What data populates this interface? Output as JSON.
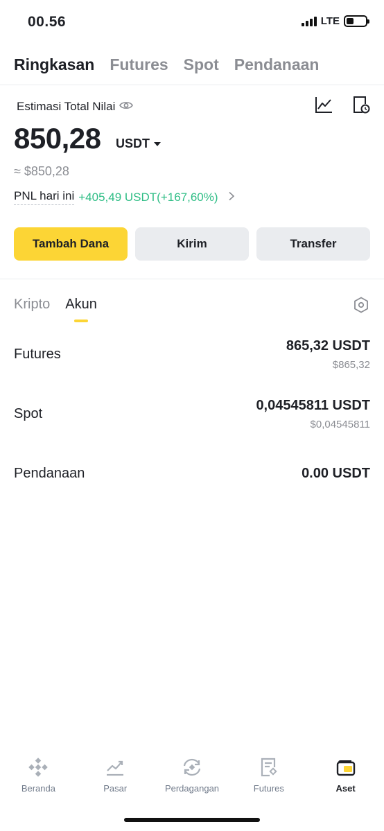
{
  "status": {
    "time": "00.56",
    "network": "LTE"
  },
  "top_tabs": [
    {
      "label": "Ringkasan",
      "active": true
    },
    {
      "label": "Futures",
      "active": false
    },
    {
      "label": "Spot",
      "active": false
    },
    {
      "label": "Pendanaan",
      "active": false
    }
  ],
  "summary": {
    "label": "Estimasi Total Nilai",
    "value": "850,28",
    "unit": "USDT",
    "usd_approx": "≈ $850,28",
    "pnl_label": "PNL hari ini",
    "pnl_value": "+405,49 USDT(+167,60%)"
  },
  "actions": {
    "deposit": "Tambah Dana",
    "send": "Kirim",
    "transfer": "Transfer"
  },
  "sub_tabs": [
    {
      "label": "Kripto",
      "active": false
    },
    {
      "label": "Akun",
      "active": true
    }
  ],
  "accounts": [
    {
      "name": "Futures",
      "value": "865,32 USDT",
      "usd": "$865,32"
    },
    {
      "name": "Spot",
      "value": "0,04545811 USDT",
      "usd": "$0,04545811"
    },
    {
      "name": "Pendanaan",
      "value": "0.00 USDT",
      "usd": ""
    }
  ],
  "bottom_nav": [
    {
      "label": "Beranda",
      "icon": "binance-logo-icon",
      "active": false
    },
    {
      "label": "Pasar",
      "icon": "market-chart-icon",
      "active": false
    },
    {
      "label": "Perdagangan",
      "icon": "trade-swap-icon",
      "active": false
    },
    {
      "label": "Futures",
      "icon": "futures-doc-icon",
      "active": false
    },
    {
      "label": "Aset",
      "icon": "wallet-icon",
      "active": true
    }
  ],
  "colors": {
    "accent": "#fcd535",
    "positive": "#2ebd85",
    "muted": "#8b8d93"
  }
}
